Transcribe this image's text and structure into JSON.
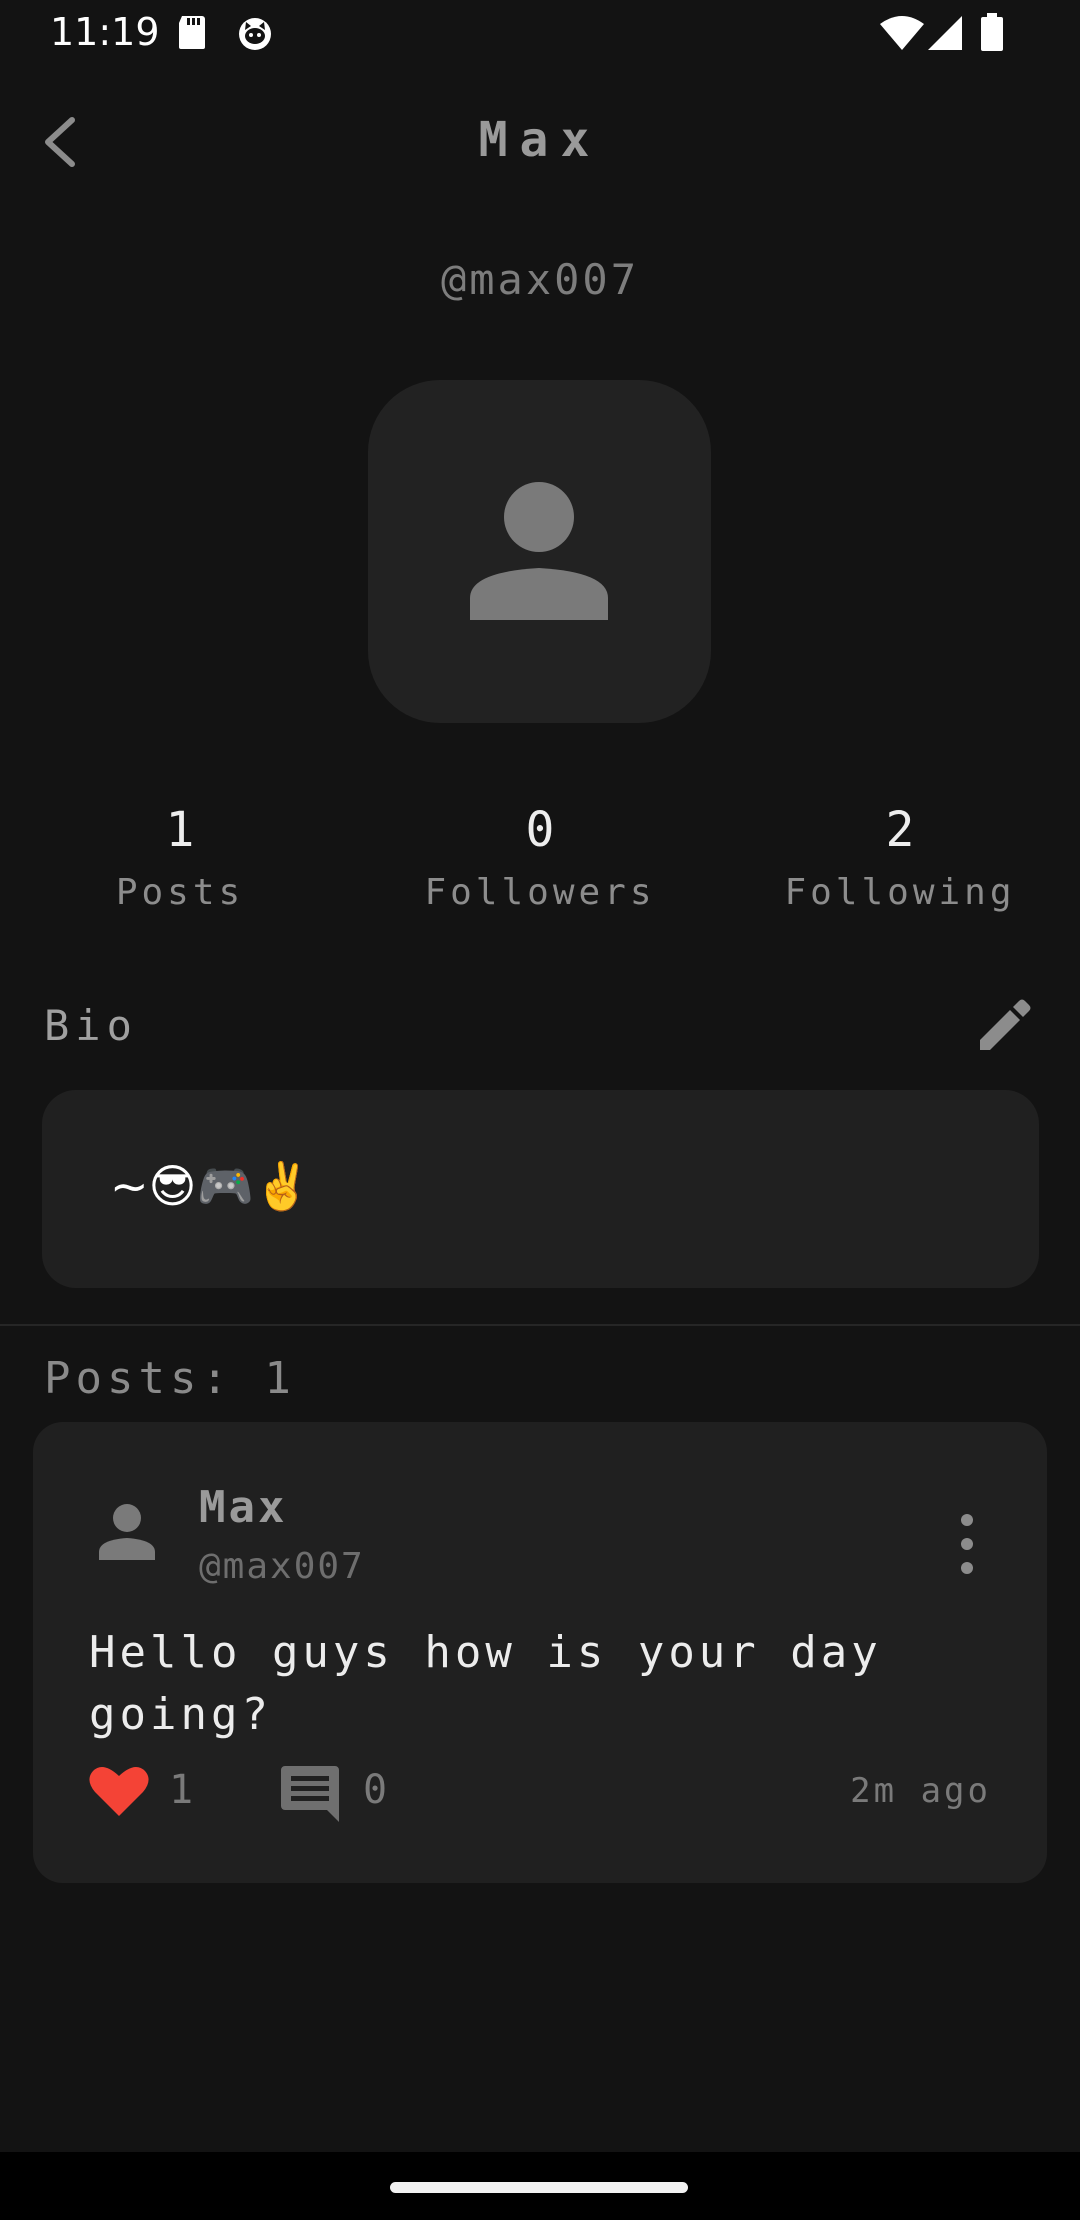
{
  "status_bar": {
    "time": "11:19",
    "left_icons": [
      "sd-card-icon",
      "cat-app-icon"
    ],
    "right_icons": [
      "wifi-icon",
      "cellular-signal-icon",
      "battery-icon"
    ]
  },
  "header": {
    "title": "Max",
    "back_icon": "chevron-left-icon"
  },
  "profile": {
    "handle": "@max007",
    "avatar_icon": "person-icon",
    "stats": [
      {
        "value": "1",
        "label": "Posts"
      },
      {
        "value": "0",
        "label": "Followers"
      },
      {
        "value": "2",
        "label": "Following"
      }
    ]
  },
  "bio": {
    "label": "Bio",
    "edit_icon": "pencil-icon",
    "text": "~😎🎮✌️"
  },
  "posts_section": {
    "heading": "Posts: 1",
    "posts": [
      {
        "author_name": "Max",
        "author_handle": "@max007",
        "text": "Hello guys how is your day going?",
        "likes": "1",
        "comments": "0",
        "time": "2m ago"
      }
    ]
  },
  "colors": {
    "background": "#131313",
    "card": "#202020",
    "like_red": "#f44336"
  }
}
